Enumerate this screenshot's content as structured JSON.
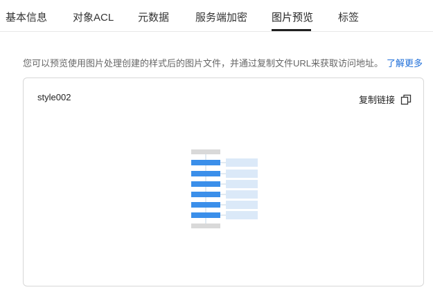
{
  "tabs": [
    {
      "label": "基本信息"
    },
    {
      "label": "对象ACL"
    },
    {
      "label": "元数据"
    },
    {
      "label": "服务端加密"
    },
    {
      "label": "图片预览",
      "active": true
    },
    {
      "label": "标签"
    }
  ],
  "notice": {
    "text": "您可以预览使用图片处理创建的样式后的图片文件，并通过复制文件URL来获取访问地址。",
    "link": "了解更多"
  },
  "card": {
    "style_name": "style002",
    "copy_label": "复制链接",
    "copy_icon": "copy-icon"
  },
  "colors": {
    "link": "#1f6fd9",
    "flow_blue": "#3b8fea",
    "flow_note": "#dbe9f8",
    "flow_grey": "#d9d9d9"
  }
}
